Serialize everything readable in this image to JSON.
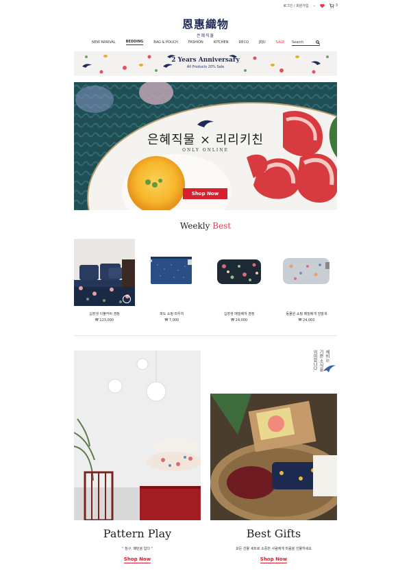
{
  "topbar": {
    "util_links": "로그인 / 회원가입",
    "cart_count": "3"
  },
  "logo": {
    "hanja": "恩惠織物",
    "hangul": "은혜직물"
  },
  "nav": {
    "items": [
      "NEW ARRIVAL",
      "BEDDING",
      "BAG & POUCH",
      "FASHION",
      "KITCHEN",
      "DECO",
      "JEJU",
      "SALE"
    ],
    "search_placeholder": "Search"
  },
  "banner": {
    "title": "2 Years Anniversary",
    "subtitle": "All Products 20% Sale"
  },
  "hero": {
    "title": "은혜직물 × 리리키친",
    "subtitle": "ONLY ONLINE",
    "button": "Shop Now"
  },
  "weekly": {
    "title": "Weekly",
    "title_accent": "Best"
  },
  "products": [
    {
      "name": "십장생 이불커버 겸정",
      "price": "₩ 123,000"
    },
    {
      "name": "파도 쇼핑 파우치",
      "price": "₩ 7,000"
    },
    {
      "name": "십장생 메밀베개 겸정",
      "price": "₩ 24,000"
    },
    {
      "name": "동물원 쇼핑 메밀베개 앙발색",
      "price": "₩ 24,000"
    }
  ],
  "vertical_text": [
    "제비는",
    "기쁜 소식을",
    "의미합니다."
  ],
  "features": {
    "left": {
      "title": "Pattern Play",
      "desc": "\" 침구, 패턴을 입다 \"",
      "link": "Shop Now"
    },
    "right": {
      "title": "Best Gifts",
      "desc": "모든 선물 세트로 소중한 사람에게 마음을 선물하세요",
      "link": "Shop Now"
    }
  },
  "colors": {
    "brand_navy": "#1f2b5a",
    "accent_red": "#d8212f",
    "accent_pink": "#e63950"
  }
}
